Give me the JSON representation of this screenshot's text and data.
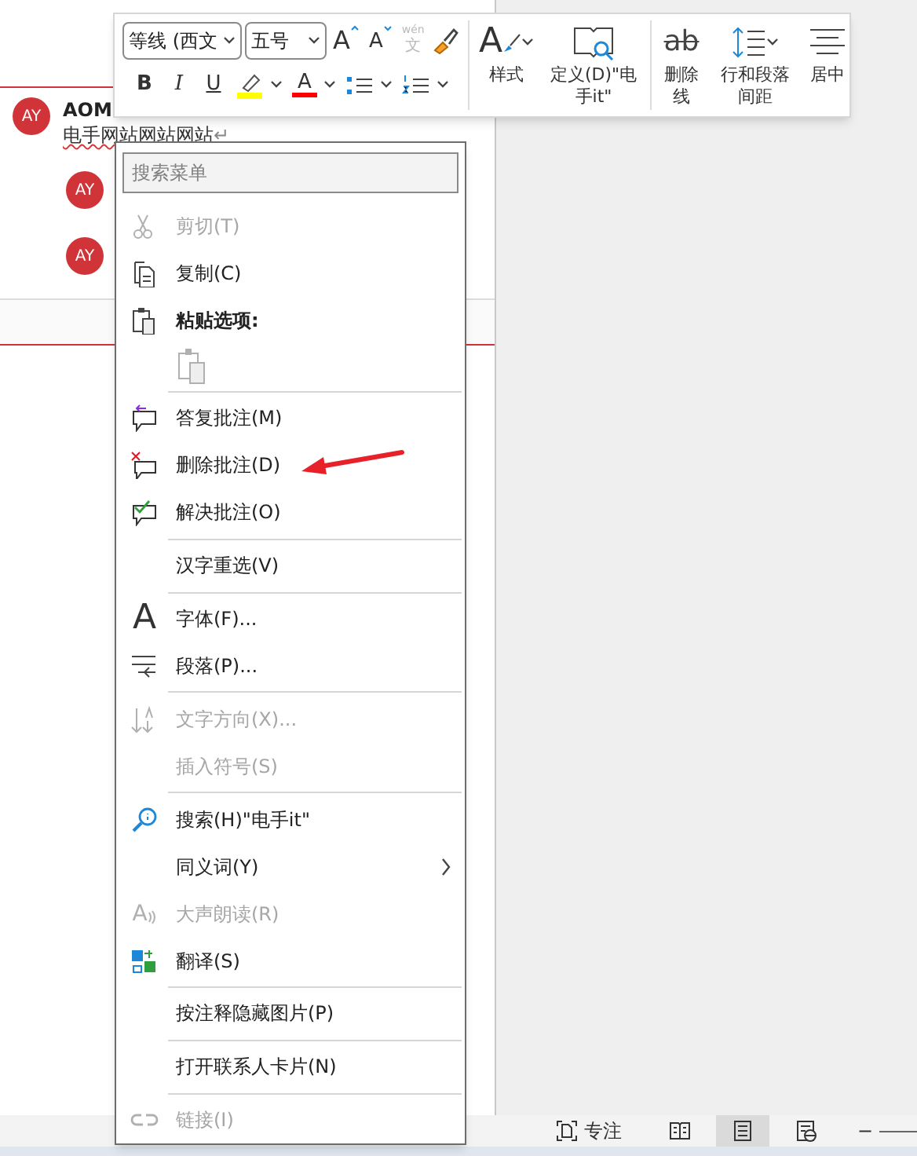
{
  "mini_toolbar": {
    "font": "等线 (西文",
    "size": "五号",
    "row1": [
      {
        "kind": "grow",
        "glyph": "A"
      },
      {
        "kind": "shrink",
        "glyph": "A"
      },
      {
        "kind": "phonetic",
        "glyph": "文",
        "top": "wén"
      },
      {
        "kind": "painter"
      }
    ],
    "row2": [
      {
        "kind": "bold",
        "glyph": "B"
      },
      {
        "kind": "italic",
        "glyph": "I"
      },
      {
        "kind": "underline",
        "glyph": "U"
      },
      {
        "kind": "highlight",
        "color": "#ffff00"
      },
      {
        "kind": "fontcolor",
        "glyph": "A",
        "color": "#ff0000"
      },
      {
        "kind": "bullets"
      },
      {
        "kind": "numbering"
      }
    ],
    "big_buttons": [
      {
        "kind": "styles",
        "glyph": "A",
        "label": "样式"
      },
      {
        "kind": "define",
        "label": "定义(D)\"电手it\""
      },
      {
        "kind": "strike",
        "glyph": "ab",
        "label": "删除线"
      },
      {
        "kind": "spacing",
        "label": "行和段落间距"
      },
      {
        "kind": "center",
        "label": "居中"
      }
    ]
  },
  "comments": [
    {
      "initials": "AY",
      "author": "AOM",
      "text": "电手网站网站网站",
      "mark": "↵"
    },
    {
      "initials": "AY"
    },
    {
      "initials": "AY"
    }
  ],
  "context_menu": {
    "search_placeholder": "搜索菜单",
    "items": [
      {
        "kind": "item",
        "label": "剪切(T)",
        "disabled": true
      },
      {
        "kind": "item",
        "label": "复制(C)",
        "disabled": false
      },
      {
        "kind": "header",
        "label": "粘贴选项:",
        "disabled": false
      },
      {
        "kind": "paste_option",
        "disabled": true
      },
      {
        "kind": "separator"
      },
      {
        "kind": "item",
        "label": "答复批注(M)",
        "disabled": false
      },
      {
        "kind": "item",
        "label": "删除批注(D)",
        "disabled": false
      },
      {
        "kind": "item",
        "label": "解决批注(O)",
        "disabled": false
      },
      {
        "kind": "separator"
      },
      {
        "kind": "item",
        "label": "汉字重选(V)",
        "disabled": false
      },
      {
        "kind": "separator"
      },
      {
        "kind": "item",
        "glyph": "A",
        "label": "字体(F)...",
        "disabled": false
      },
      {
        "kind": "item",
        "label": "段落(P)...",
        "disabled": false
      },
      {
        "kind": "separator"
      },
      {
        "kind": "item",
        "label": "文字方向(X)...",
        "disabled": true
      },
      {
        "kind": "item",
        "label": "插入符号(S)",
        "disabled": true
      },
      {
        "kind": "separator"
      },
      {
        "kind": "item",
        "label": "搜索(H)\"电手it\"",
        "disabled": false
      },
      {
        "kind": "submenu",
        "label": "同义词(Y)",
        "disabled": false
      },
      {
        "kind": "item",
        "glyph": "A",
        "label": "大声朗读(R)",
        "disabled": true
      },
      {
        "kind": "item",
        "label": "翻译(S)",
        "disabled": false
      },
      {
        "kind": "separator"
      },
      {
        "kind": "item",
        "label": "按注释隐藏图片(P)",
        "disabled": false
      },
      {
        "kind": "separator"
      },
      {
        "kind": "item",
        "label": "打开联系人卡片(N)",
        "disabled": false
      },
      {
        "kind": "separator"
      },
      {
        "kind": "item",
        "label": "链接(I)",
        "disabled": true
      }
    ]
  },
  "status_bar": {
    "focus": "专注",
    "views": [
      {
        "kind": "read",
        "selected": false
      },
      {
        "kind": "print",
        "selected": true
      },
      {
        "kind": "web",
        "selected": false
      }
    ],
    "zoom_out": "−"
  }
}
